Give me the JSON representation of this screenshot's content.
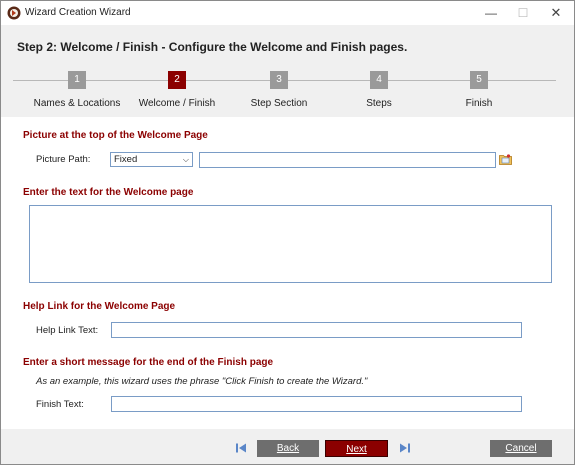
{
  "window": {
    "title": "Wizard Creation Wizard",
    "minimize": "—",
    "maximize": "☐",
    "close": "✕"
  },
  "header": {
    "title": "Step 2: Welcome / Finish - Configure the Welcome and Finish pages."
  },
  "steps": [
    {
      "number": "1",
      "label": "Names & Locations",
      "active": false
    },
    {
      "number": "2",
      "label": "Welcome / Finish",
      "active": true
    },
    {
      "number": "3",
      "label": "Step Section",
      "active": false
    },
    {
      "number": "4",
      "label": "Steps",
      "active": false
    },
    {
      "number": "5",
      "label": "Finish",
      "active": false
    }
  ],
  "picture": {
    "heading": "Picture at the top of the Welcome Page",
    "path_label": "Picture Path:",
    "path_type": "Fixed",
    "path_value": ""
  },
  "welcome_text": {
    "heading": "Enter the text for the Welcome page",
    "value": ""
  },
  "help_link": {
    "heading": "Help Link for the Welcome Page",
    "label": "Help Link Text:",
    "value": ""
  },
  "finish": {
    "heading": "Enter a short message for the end of the Finish page",
    "note": "As an example, this wizard uses the phrase \"Click Finish to create the Wizard.\"",
    "label": "Finish Text:",
    "value": ""
  },
  "footer": {
    "back_label": "Back",
    "next_label": "Next",
    "cancel_label": "Cancel"
  },
  "colors": {
    "accent": "#8b0000",
    "step_inactive": "#9a9a9a",
    "button_gray": "#6e6e6e",
    "field_border": "#7a9cc6"
  }
}
